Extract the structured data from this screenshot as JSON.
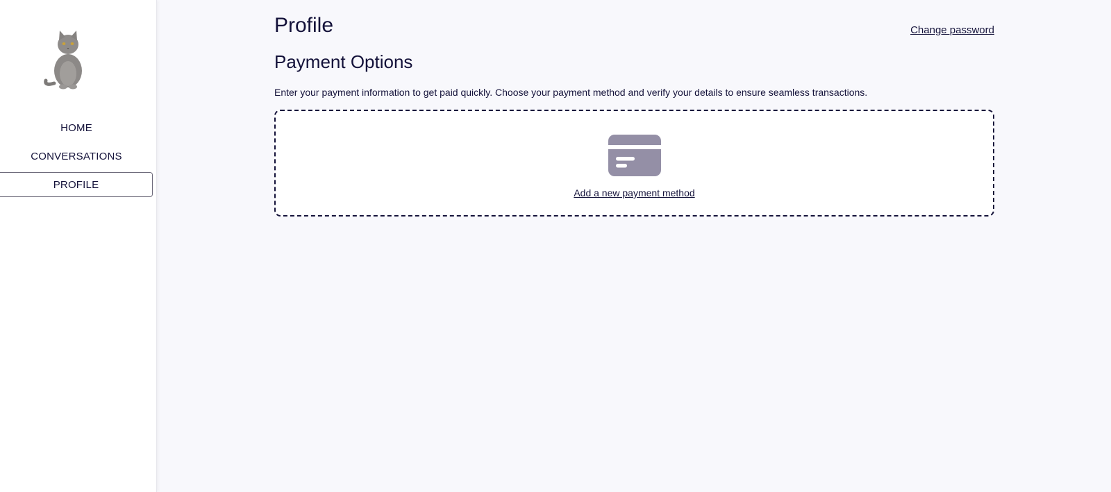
{
  "sidebar": {
    "logo_icon": "cat-logo",
    "items": [
      {
        "label": "HOME",
        "active": false
      },
      {
        "label": "CONVERSATIONS",
        "active": false
      },
      {
        "label": "PROFILE",
        "active": true
      }
    ]
  },
  "header": {
    "title": "Profile",
    "change_password_label": "Change password"
  },
  "payment": {
    "section_title": "Payment Options",
    "description": "Enter your payment information to get paid quickly. Choose your payment method and verify your details to ensure seamless transactions.",
    "add_method_label": "Add a new payment method",
    "icon": "credit-card-icon"
  },
  "colors": {
    "background": "#f8f8fc",
    "text": "#14123a",
    "card_icon": "#948fa6"
  }
}
